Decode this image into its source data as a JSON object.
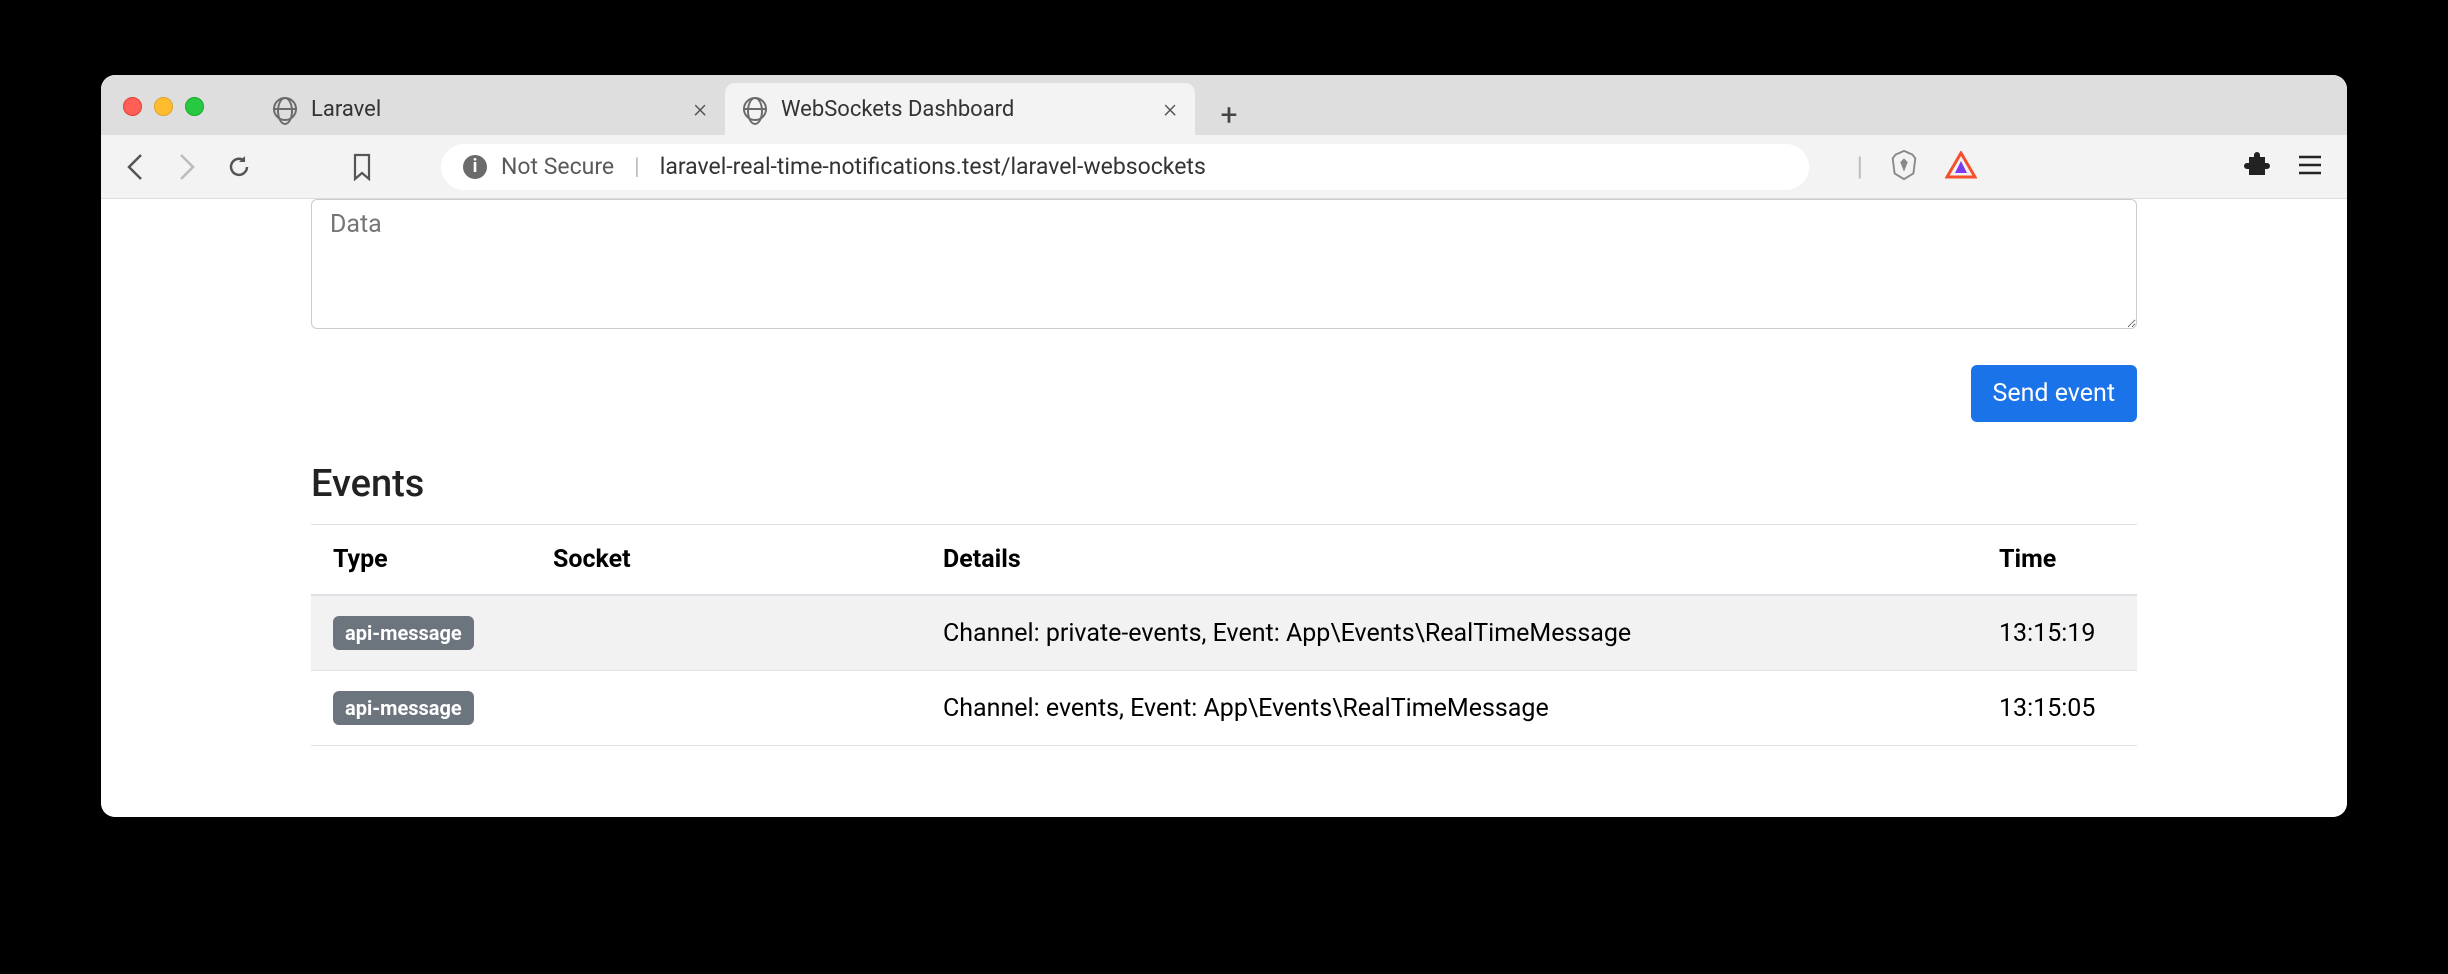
{
  "tabs": [
    {
      "title": "Laravel",
      "active": false
    },
    {
      "title": "WebSockets Dashboard",
      "active": true
    }
  ],
  "address": {
    "security_label": "Not Secure",
    "url": "laravel-real-time-notifications.test/laravel-websockets"
  },
  "form": {
    "data_placeholder": "Data",
    "send_label": "Send event"
  },
  "events": {
    "heading": "Events",
    "columns": {
      "type": "Type",
      "socket": "Socket",
      "details": "Details",
      "time": "Time"
    },
    "rows": [
      {
        "type": "api-message",
        "socket": "",
        "details": "Channel: private-events, Event: App\\Events\\RealTimeMessage",
        "time": "13:15:19"
      },
      {
        "type": "api-message",
        "socket": "",
        "details": "Channel: events, Event: App\\Events\\RealTimeMessage",
        "time": "13:15:05"
      }
    ]
  }
}
